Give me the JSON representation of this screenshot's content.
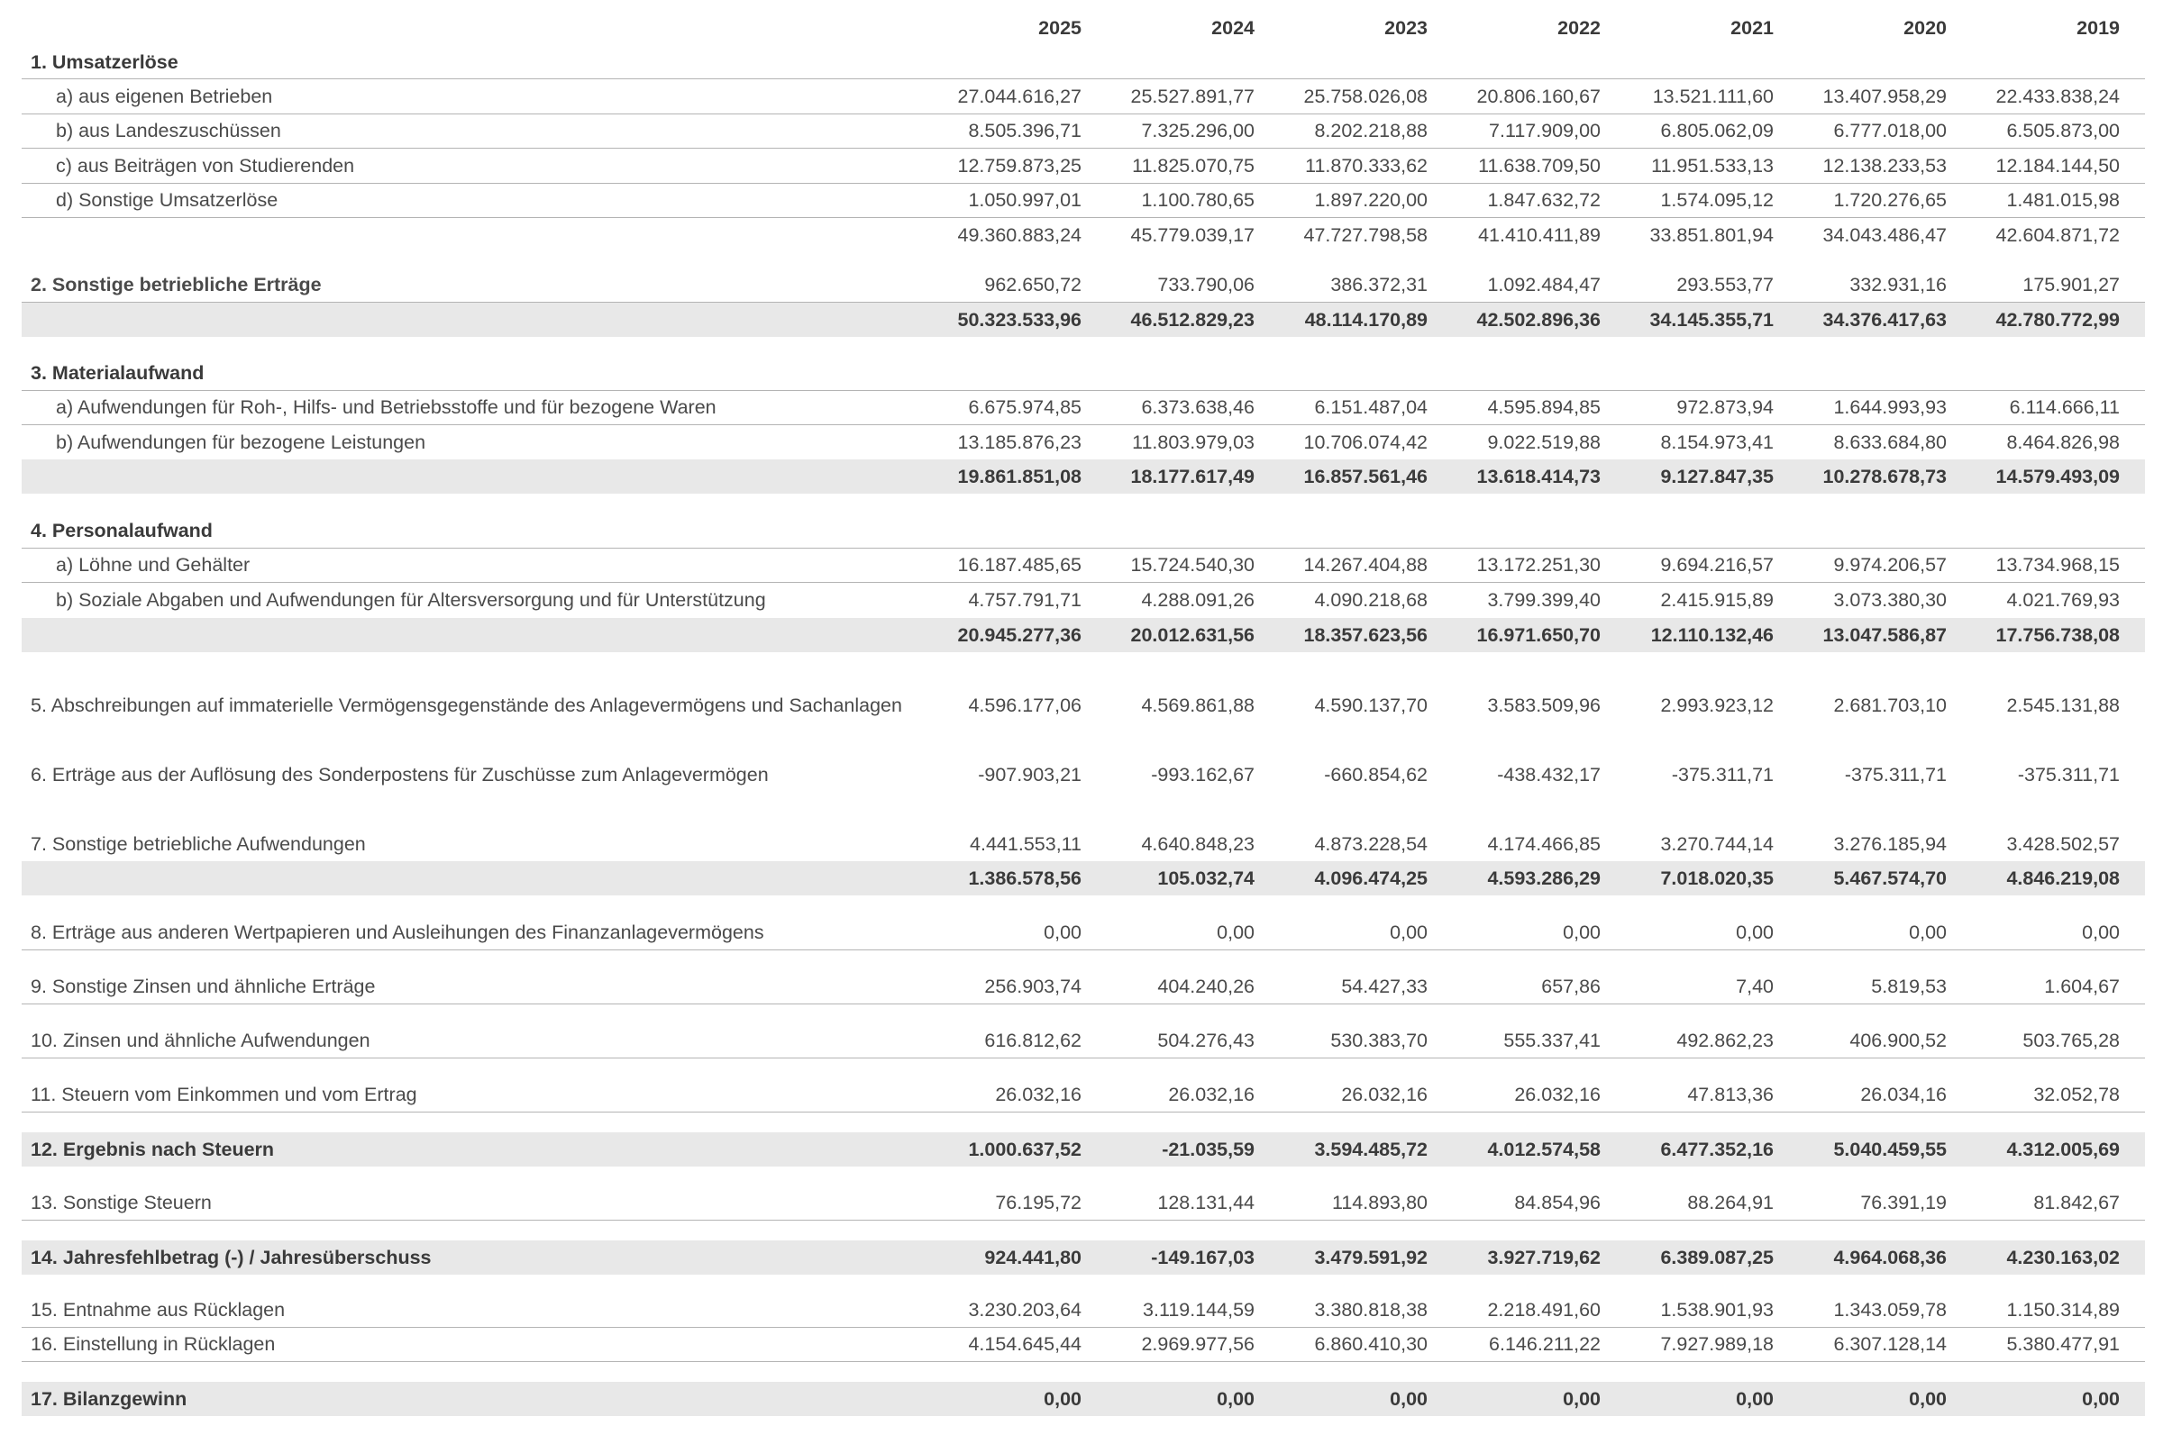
{
  "years": [
    "2025",
    "2024",
    "2023",
    "2022",
    "2021",
    "2020",
    "2019"
  ],
  "rows": [
    {
      "label": "1. Umsatzerlöse",
      "values": [],
      "bold": true
    },
    {
      "label": "a) aus eigenen Betrieben",
      "values": [
        "27.044.616,27",
        "25.527.891,77",
        "25.758.026,08",
        "20.806.160,67",
        "13.521.111,60",
        "13.407.958,29",
        "22.433.838,24"
      ],
      "sub": true
    },
    {
      "label": "b) aus  Landeszuschüssen",
      "values": [
        "8.505.396,71",
        "7.325.296,00",
        "8.202.218,88",
        "7.117.909,00",
        "6.805.062,09",
        "6.777.018,00",
        "6.505.873,00"
      ],
      "sub": true
    },
    {
      "label": "c) aus  Beiträgen von Studierenden",
      "values": [
        "12.759.873,25",
        "11.825.070,75",
        "11.870.333,62",
        "11.638.709,50",
        "11.951.533,13",
        "12.138.233,53",
        "12.184.144,50"
      ],
      "sub": true
    },
    {
      "label": "d) Sonstige Umsatzerlöse",
      "values": [
        "1.050.997,01",
        "1.100.780,65",
        "1.897.220,00",
        "1.847.632,72",
        "1.574.095,12",
        "1.720.276,65",
        "1.481.015,98"
      ],
      "sub": true
    },
    {
      "label": "",
      "values": [
        "49.360.883,24",
        "45.779.039,17",
        "47.727.798,58",
        "41.410.411,89",
        "33.851.801,94",
        "34.043.486,47",
        "42.604.871,72"
      ]
    },
    {
      "label": "2. Sonstige betriebliche Erträge",
      "values": [
        "962.650,72",
        "733.790,06",
        "386.372,31",
        "1.092.484,47",
        "293.553,77",
        "332.931,16",
        "175.901,27"
      ],
      "bold_label": true
    },
    {
      "label": "",
      "values": [
        "50.323.533,96",
        "46.512.829,23",
        "48.114.170,89",
        "42.502.896,36",
        "34.145.355,71",
        "34.376.417,63",
        "42.780.772,99"
      ],
      "bold": true,
      "shade": true
    },
    {
      "label": "3. Materialaufwand",
      "values": [],
      "bold": true
    },
    {
      "label": "a) Aufwendungen für Roh-, Hilfs- und Betriebsstoffe und für bezogene Waren",
      "values": [
        "6.675.974,85",
        "6.373.638,46",
        "6.151.487,04",
        "4.595.894,85",
        "972.873,94",
        "1.644.993,93",
        "6.114.666,11"
      ],
      "sub": true
    },
    {
      "label": "b) Aufwendungen für bezogene Leistungen",
      "values": [
        "13.185.876,23",
        "11.803.979,03",
        "10.706.074,42",
        "9.022.519,88",
        "8.154.973,41",
        "8.633.684,80",
        "8.464.826,98"
      ],
      "sub": true
    },
    {
      "label": "",
      "values": [
        "19.861.851,08",
        "18.177.617,49",
        "16.857.561,46",
        "13.618.414,73",
        "9.127.847,35",
        "10.278.678,73",
        "14.579.493,09"
      ],
      "bold": true,
      "shade": true
    },
    {
      "label": "4. Personalaufwand",
      "values": [],
      "bold": true
    },
    {
      "label": "a) Löhne und Gehälter",
      "values": [
        "16.187.485,65",
        "15.724.540,30",
        "14.267.404,88",
        "13.172.251,30",
        "9.694.216,57",
        "9.974.206,57",
        "13.734.968,15"
      ],
      "sub": true
    },
    {
      "label": "b) Soziale Abgaben und Aufwendungen für Altersversorgung und für Unterstützung",
      "values": [
        "4.757.791,71",
        "4.288.091,26",
        "4.090.218,68",
        "3.799.399,40",
        "2.415.915,89",
        "3.073.380,30",
        "4.021.769,93"
      ],
      "sub": true
    },
    {
      "label": "",
      "values": [
        "20.945.277,36",
        "20.012.631,56",
        "18.357.623,56",
        "16.971.650,70",
        "12.110.132,46",
        "13.047.586,87",
        "17.756.738,08"
      ],
      "bold": true,
      "shade": true
    },
    {
      "label": "5. Abschreibungen auf immaterielle Vermögensgegenstände des Anlagevermögens und Sachanlagen",
      "values": [
        "4.596.177,06",
        "4.569.861,88",
        "4.590.137,70",
        "3.583.509,96",
        "2.993.923,12",
        "2.681.703,10",
        "2.545.131,88"
      ]
    },
    {
      "label": "6. Erträge aus der Auflösung des Sonderpostens für Zuschüsse zum Anlagevermögen",
      "values": [
        "-907.903,21",
        "-993.162,67",
        "-660.854,62",
        "-438.432,17",
        "-375.311,71",
        "-375.311,71",
        "-375.311,71"
      ]
    },
    {
      "label": "7. Sonstige betriebliche Aufwendungen",
      "values": [
        "4.441.553,11",
        "4.640.848,23",
        "4.873.228,54",
        "4.174.466,85",
        "3.270.744,14",
        "3.276.185,94",
        "3.428.502,57"
      ]
    },
    {
      "label": "",
      "values": [
        "1.386.578,56",
        "105.032,74",
        "4.096.474,25",
        "4.593.286,29",
        "7.018.020,35",
        "5.467.574,70",
        "4.846.219,08"
      ],
      "bold": true,
      "shade": true
    },
    {
      "label": "8. Erträge aus anderen Wertpapieren und Ausleihungen des Finanzanlagevermögens",
      "values": [
        "0,00",
        "0,00",
        "0,00",
        "0,00",
        "0,00",
        "0,00",
        "0,00"
      ]
    },
    {
      "label": "9. Sonstige Zinsen und ähnliche Erträge",
      "values": [
        "256.903,74",
        "404.240,26",
        "54.427,33",
        "657,86",
        "7,40",
        "5.819,53",
        "1.604,67"
      ]
    },
    {
      "label": "10. Zinsen und ähnliche  Aufwendungen",
      "values": [
        "616.812,62",
        "504.276,43",
        "530.383,70",
        "555.337,41",
        "492.862,23",
        "406.900,52",
        "503.765,28"
      ]
    },
    {
      "label": "11. Steuern vom Einkommen und vom Ertrag",
      "values": [
        "26.032,16",
        "26.032,16",
        "26.032,16",
        "26.032,16",
        "47.813,36",
        "26.034,16",
        "32.052,78"
      ]
    },
    {
      "label": "12. Ergebnis nach Steuern",
      "values": [
        "1.000.637,52",
        "-21.035,59",
        "3.594.485,72",
        "4.012.574,58",
        "6.477.352,16",
        "5.040.459,55",
        "4.312.005,69"
      ],
      "bold": true,
      "shade": true
    },
    {
      "label": "13. Sonstige Steuern",
      "values": [
        "76.195,72",
        "128.131,44",
        "114.893,80",
        "84.854,96",
        "88.264,91",
        "76.391,19",
        "81.842,67"
      ]
    },
    {
      "label": "14. Jahresfehlbetrag (-) / Jahresüberschuss",
      "values": [
        "924.441,80",
        "-149.167,03",
        "3.479.591,92",
        "3.927.719,62",
        "6.389.087,25",
        "4.964.068,36",
        "4.230.163,02"
      ],
      "bold": true,
      "shade": true
    },
    {
      "label": "15. Entnahme aus Rücklagen",
      "values": [
        "3.230.203,64",
        "3.119.144,59",
        "3.380.818,38",
        "2.218.491,60",
        "1.538.901,93",
        "1.343.059,78",
        "1.150.314,89"
      ]
    },
    {
      "label": "16. Einstellung in Rücklagen",
      "values": [
        "4.154.645,44",
        "2.969.977,56",
        "6.860.410,30",
        "6.146.211,22",
        "7.927.989,18",
        "6.307.128,14",
        "5.380.477,91"
      ]
    },
    {
      "label": "17. Bilanzgewinn",
      "values": [
        "0,00",
        "0,00",
        "0,00",
        "0,00",
        "0,00",
        "0,00",
        "0,00"
      ],
      "bold": true,
      "shade": true
    }
  ]
}
